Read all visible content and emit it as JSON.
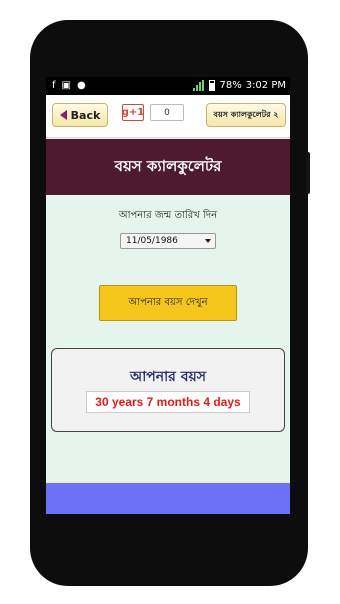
{
  "status_bar": {
    "battery": "78%",
    "time": "3:02 PM"
  },
  "toolbar": {
    "back_label": "Back",
    "gplus_label": "g+1",
    "gplus_count": "0",
    "calc2_label": "বয়স ক্যালকুলেটর ২"
  },
  "page": {
    "title": "বয়স ক্যালকুলেটর",
    "prompt": "আপনার জন্ম তারিখ দিন",
    "date_value": "11/05/1986",
    "show_button": "আপনার বয়স দেখুন"
  },
  "result": {
    "heading": "আপনার বয়স",
    "value": "30 years 7 months 4 days"
  },
  "colors": {
    "banner": "#4e1a2f",
    "background": "#e5f4ec",
    "button": "#f7c61c",
    "result_text": "#e01b1b",
    "bottom_bar": "#6b72f5"
  }
}
